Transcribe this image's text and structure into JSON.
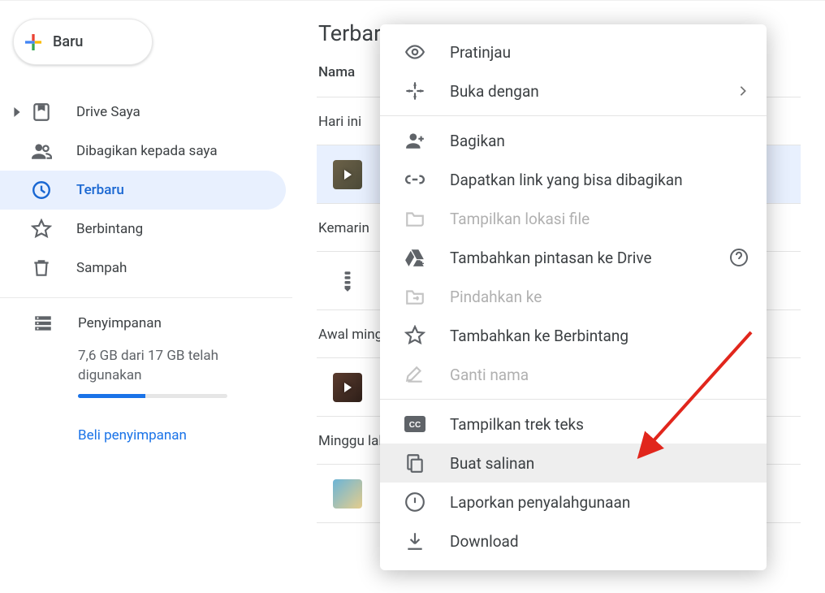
{
  "sidebar": {
    "new_label": "Baru",
    "items": [
      {
        "label": "Drive Saya",
        "icon": "drive-icon",
        "expandable": true
      },
      {
        "label": "Dibagikan kepada saya",
        "icon": "shared-icon"
      },
      {
        "label": "Terbaru",
        "icon": "recent-icon",
        "active": true
      },
      {
        "label": "Berbintang",
        "icon": "star-icon"
      },
      {
        "label": "Sampah",
        "icon": "trash-icon"
      }
    ],
    "storage": {
      "label": "Penyimpanan",
      "usage_text": "7,6 GB dari 17 GB telah digunakan",
      "fill_percent": 45,
      "buy_text": "Beli penyimpanan"
    }
  },
  "main": {
    "title": "Terbaru",
    "column_header": "Nama",
    "sections": [
      {
        "label": "Hari ini",
        "rows": [
          {
            "type": "video-thumb",
            "variant": "v1",
            "selected": true
          }
        ]
      },
      {
        "label": "Kemarin",
        "rows": [
          {
            "type": "jamboard-icon"
          }
        ]
      },
      {
        "label": "Awal minggu ini",
        "rows": [
          {
            "type": "video-thumb",
            "variant": "v2"
          }
        ]
      },
      {
        "label": "Minggu lalu",
        "rows": [
          {
            "type": "image-thumb",
            "variant": "v3"
          }
        ]
      }
    ]
  },
  "context_menu": {
    "items": [
      {
        "label": "Pratinjau",
        "icon": "eye-icon"
      },
      {
        "label": "Buka dengan",
        "icon": "open-with-icon",
        "has_submenu": true
      },
      {
        "separator": true
      },
      {
        "label": "Bagikan",
        "icon": "person-add-icon"
      },
      {
        "label": "Dapatkan link yang bisa dibagikan",
        "icon": "link-icon"
      },
      {
        "label": "Tampilkan lokasi file",
        "icon": "folder-icon",
        "disabled": true
      },
      {
        "label": "Tambahkan pintasan ke Drive",
        "icon": "drive-add-icon",
        "help": true
      },
      {
        "label": "Pindahkan ke",
        "icon": "move-to-icon",
        "disabled": true
      },
      {
        "label": "Tambahkan ke Berbintang",
        "icon": "star-icon"
      },
      {
        "label": "Ganti nama",
        "icon": "rename-icon",
        "disabled": true
      },
      {
        "separator": true
      },
      {
        "label": "Tampilkan trek teks",
        "icon": "cc-icon"
      },
      {
        "label": "Buat salinan",
        "icon": "copy-icon",
        "hover": true
      },
      {
        "label": "Laporkan penyalahgunaan",
        "icon": "report-icon"
      },
      {
        "label": "Download",
        "icon": "download-icon"
      }
    ]
  }
}
